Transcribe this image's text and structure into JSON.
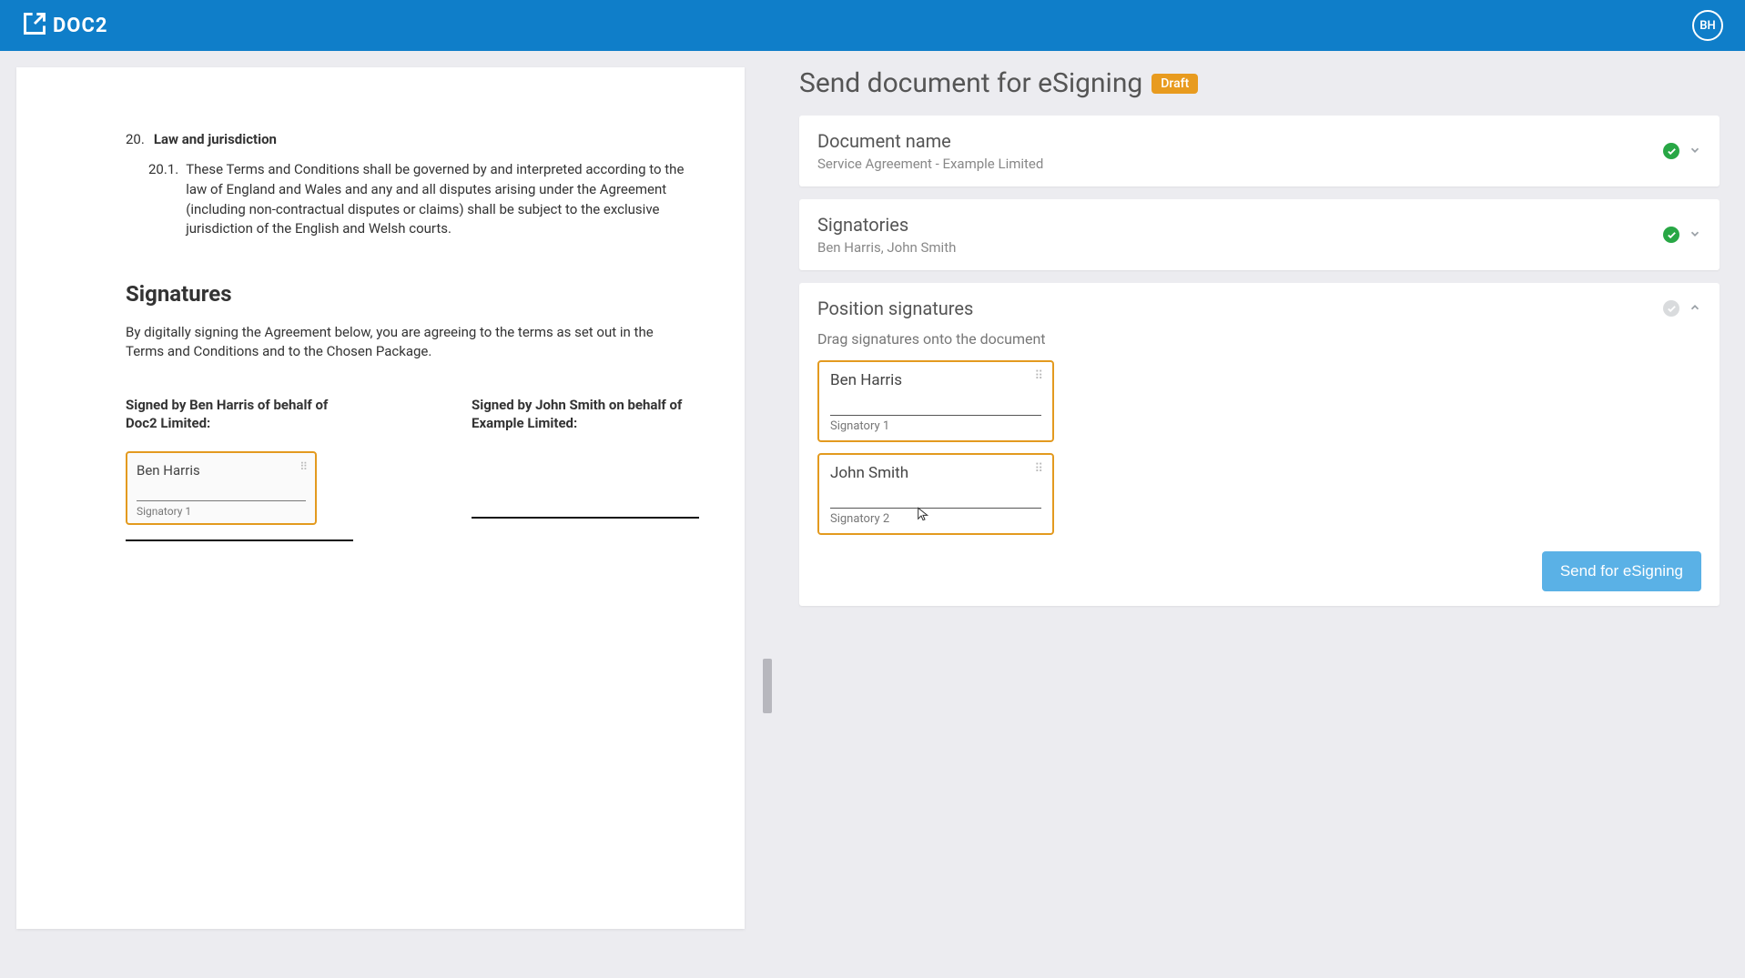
{
  "header": {
    "logo_text": "DOC2",
    "avatar_initials": "BH"
  },
  "document": {
    "section_20_num": "20.",
    "section_20_title": "Law and jurisdiction",
    "clause_201_num": "20.1.",
    "clause_201_text": "These Terms and Conditions shall be governed by and interpreted according to the law of England and Wales and any and all disputes arising under the Agreement (including non-contractual disputes or claims) shall be subject to the exclusive jurisdiction of the English and Welsh courts.",
    "signatures_heading": "Signatures",
    "signatures_intro": "By digitally signing the Agreement below, you are agreeing to the terms as set out in the Terms and Conditions and to the Chosen Package.",
    "sign_col1_label": "Signed by Ben Harris of behalf of Doc2 Limited:",
    "sign_col2_label": "Signed by John Smith on behalf of Example Limited:",
    "placed_sig_name": "Ben Harris",
    "placed_sig_role": "Signatory 1"
  },
  "side": {
    "title": "Send document for eSigning",
    "status_badge": "Draft",
    "doc_name_title": "Document name",
    "doc_name_value": "Service Agreement - Example Limited",
    "signatories_title": "Signatories",
    "signatories_value": "Ben Harris, John Smith",
    "position_title": "Position signatures",
    "position_instr": "Drag signatures onto the document",
    "sig_blocks": [
      {
        "name": "Ben Harris",
        "role": "Signatory 1"
      },
      {
        "name": "John Smith",
        "role": "Signatory 2"
      }
    ],
    "send_button": "Send for eSigning"
  }
}
